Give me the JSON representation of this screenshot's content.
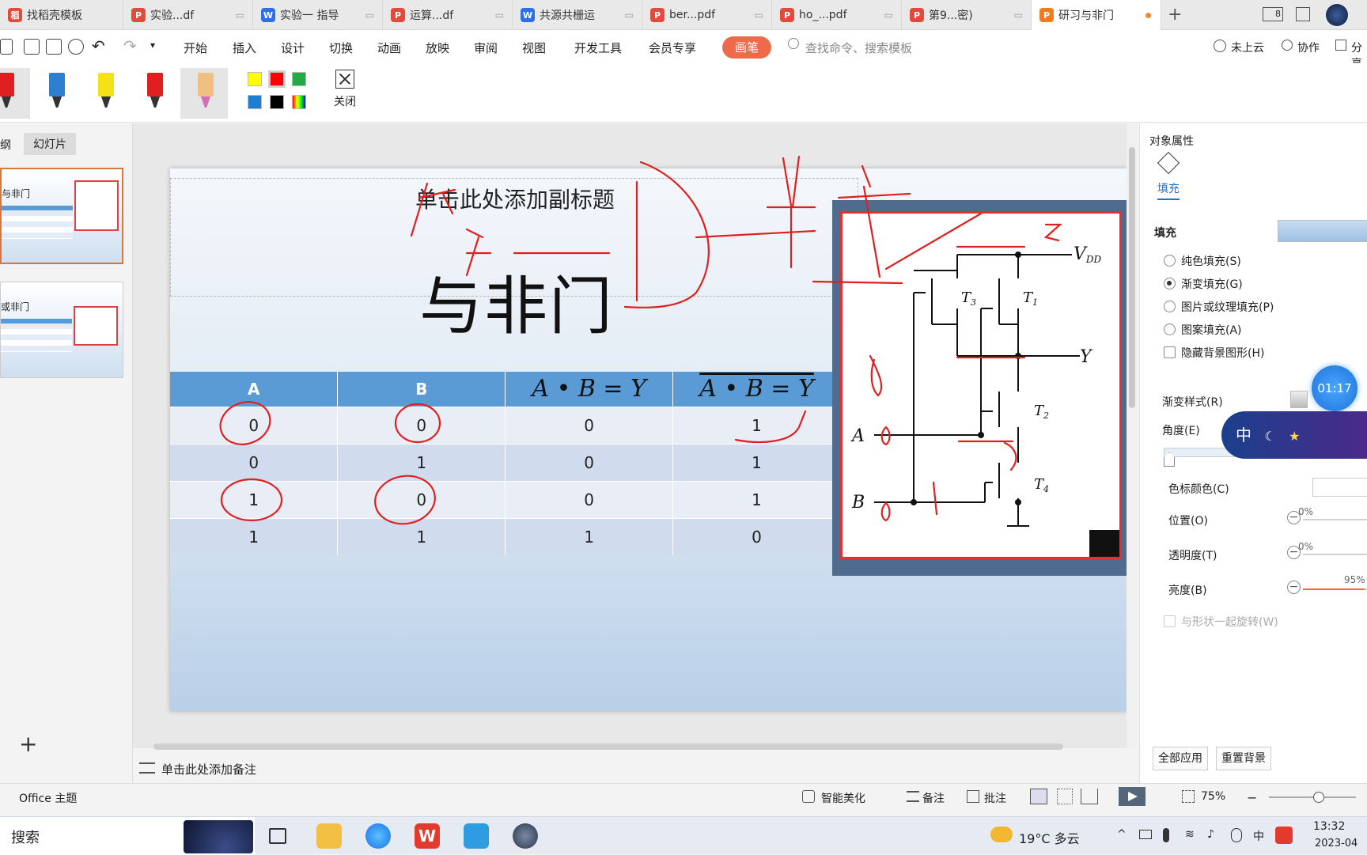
{
  "tabs": [
    {
      "label": "找稻壳模板",
      "kind": "wps-home"
    },
    {
      "label": "实验...df",
      "kind": "pdf"
    },
    {
      "label": "实验一 指导",
      "kind": "wps"
    },
    {
      "label": "运算...df",
      "kind": "pdf"
    },
    {
      "label": "共源共栅运",
      "kind": "wps"
    },
    {
      "label": "ber...pdf",
      "kind": "pdf"
    },
    {
      "label": "ho_...pdf",
      "kind": "pdf"
    },
    {
      "label": "第9...密)",
      "kind": "pdf"
    },
    {
      "label": "研习与非门",
      "kind": "ppt",
      "active": true
    }
  ],
  "tabbar_right": {
    "badge": "8"
  },
  "menu": {
    "items": [
      "开始",
      "插入",
      "设计",
      "切换",
      "动画",
      "放映",
      "审阅",
      "视图",
      "开发工具",
      "会员专享"
    ],
    "active_tab": "画笔",
    "search_placeholder": "查找命令、搜索模板",
    "right": {
      "cloud": "未上云",
      "collab": "协作",
      "share": "分享"
    }
  },
  "pen_toolbar": {
    "pens": [
      {
        "name": "red-marker",
        "color": "#e02020"
      },
      {
        "name": "blue-marker",
        "color": "#2f7fd1"
      },
      {
        "name": "yellow-highlighter",
        "color": "#f5e216"
      },
      {
        "name": "red-pen",
        "color": "#e02020"
      },
      {
        "name": "eraser",
        "color": "#f0c080",
        "selected": true
      }
    ],
    "swatches": [
      "#ffff00",
      "#ff0000",
      "#22aa44",
      "#1e7ed2",
      "#000000"
    ],
    "close_label": "关闭"
  },
  "left_panel": {
    "tabs": [
      "纲",
      "幻灯片"
    ],
    "thumbs": [
      {
        "index": "1",
        "label": "与非门",
        "selected": true
      },
      {
        "index": "2",
        "label": "或非门",
        "selected": false
      }
    ],
    "add_label": "+"
  },
  "slide": {
    "subtitle": "单击此处添加副标题",
    "title": "与非门",
    "table": {
      "headers": [
        "A",
        "B",
        "A • B = Y",
        "A • B = Y"
      ],
      "rows": [
        [
          "0",
          "0",
          "0",
          "1"
        ],
        [
          "0",
          "1",
          "0",
          "1"
        ],
        [
          "1",
          "0",
          "0",
          "1"
        ],
        [
          "1",
          "1",
          "1",
          "0"
        ]
      ]
    },
    "circuit": {
      "vdd": "V",
      "vdd_sub": "DD",
      "y": "Y",
      "a": "A",
      "b": "B",
      "t1": "T",
      "t1_sub": "1",
      "t2": "T",
      "t2_sub": "2",
      "t3": "T",
      "t3_sub": "3",
      "t4": "T",
      "t4_sub": "4"
    }
  },
  "notes_placeholder": "单击此处添加备注",
  "right_panel": {
    "title": "对象属性",
    "fill_tab": "填充",
    "section": "填充",
    "options": [
      {
        "label": "纯色填充(S)",
        "type": "radio",
        "on": false
      },
      {
        "label": "渐变填充(G)",
        "type": "radio",
        "on": true
      },
      {
        "label": "图片或纹理填充(P)",
        "type": "radio",
        "on": false
      },
      {
        "label": "图案填充(A)",
        "type": "radio",
        "on": false
      },
      {
        "label": "隐藏背景图形(H)",
        "type": "check",
        "on": false
      }
    ],
    "gradient_style": "渐变样式(R)",
    "angle": "角度(E)",
    "stop_color": "色标颜色(C)",
    "position": {
      "label": "位置(O)",
      "value": "0%",
      "fraction": 0
    },
    "transparency": {
      "label": "透明度(T)",
      "value": "0%",
      "fraction": 0
    },
    "brightness": {
      "label": "亮度(B)",
      "value": "95%",
      "fraction": 0.95
    },
    "rotate_with_shape": "与形状一起旋转(W)",
    "apply_all": "全部应用",
    "reset_bg": "重置背景"
  },
  "timer": "01:17",
  "ime": "中",
  "status_bar": {
    "theme": "Office 主题",
    "beautify": "智能美化",
    "notes": "备注",
    "comments": "批注",
    "zoom": "75%"
  },
  "taskbar": {
    "search": "搜索",
    "weather": "19°C 多云",
    "ime": "中",
    "time": "13:32",
    "date": "2023-04"
  }
}
